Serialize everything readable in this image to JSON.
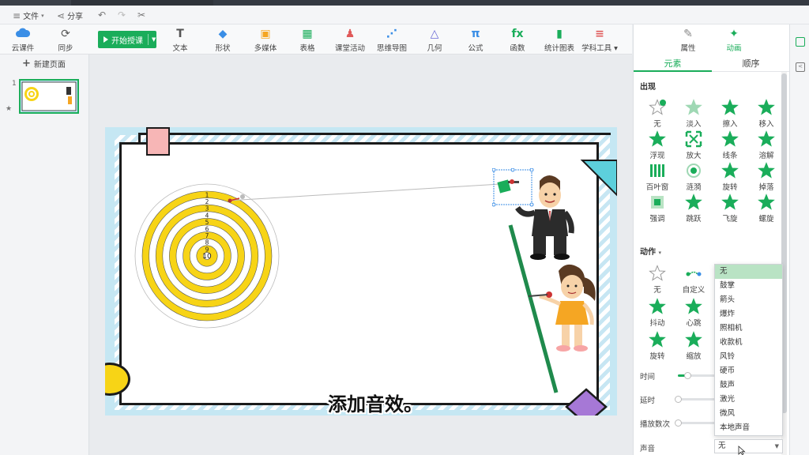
{
  "menu": {
    "file": "文件",
    "share": "分享"
  },
  "toolbar": {
    "cloud": "云课件",
    "sync": "同步",
    "start": "开始授课",
    "tools": [
      {
        "name": "text",
        "label": "文本",
        "icon": "T"
      },
      {
        "name": "shape",
        "label": "形状",
        "icon": "◆"
      },
      {
        "name": "media",
        "label": "多媒体",
        "icon": "▣"
      },
      {
        "name": "table",
        "label": "表格",
        "icon": "▦"
      },
      {
        "name": "class-activity",
        "label": "课堂活动",
        "icon": "♟"
      },
      {
        "name": "mindmap",
        "label": "思维导图",
        "icon": "⋰"
      },
      {
        "name": "geometry",
        "label": "几何",
        "icon": "△"
      },
      {
        "name": "formula",
        "label": "公式",
        "icon": "π"
      },
      {
        "name": "function",
        "label": "函数",
        "icon": "fx"
      },
      {
        "name": "chart",
        "label": "统计图表",
        "icon": "▮"
      },
      {
        "name": "subject-tools",
        "label": "学科工具",
        "icon": "≡"
      }
    ]
  },
  "left": {
    "new_page": "新建页面",
    "slide_number": "1"
  },
  "caption": "添加音效。",
  "right": {
    "tab_props": "属性",
    "tab_anim": "动画",
    "sub_elements": "元素",
    "sub_order": "顺序",
    "appear_title": "出现",
    "appear_items": [
      "无",
      "淡入",
      "擦入",
      "移入",
      "浮现",
      "放大",
      "线条",
      "溶解",
      "百叶窗",
      "涟漪",
      "旋转",
      "掉落",
      "强调",
      "跳跃",
      "飞旋",
      "螺旋"
    ],
    "action_title": "动作",
    "action_items": [
      "无",
      "自定义",
      "抖动",
      "心跳",
      "旋转",
      "缩放"
    ],
    "time_label": "时间",
    "delay_label": "延时",
    "repeat_label": "播放数次",
    "sound_label": "声音",
    "sound_value": "无",
    "time_level": 0.2,
    "delay_level": 0.0,
    "repeat_level": 0.0
  },
  "sound_options": [
    "无",
    "鼓掌",
    "箭头",
    "爆炸",
    "照相机",
    "收款机",
    "风铃",
    "硬币",
    "鼓声",
    "激光",
    "微风",
    "本地声音"
  ],
  "dart_numbers": [
    "1",
    "2",
    "3",
    "4",
    "5",
    "6",
    "7",
    "8",
    "9",
    "10"
  ],
  "colors": {
    "accent": "#1aad5a",
    "dart_yellow": "#f7d416",
    "frame_blue": "#c5e7f3"
  }
}
